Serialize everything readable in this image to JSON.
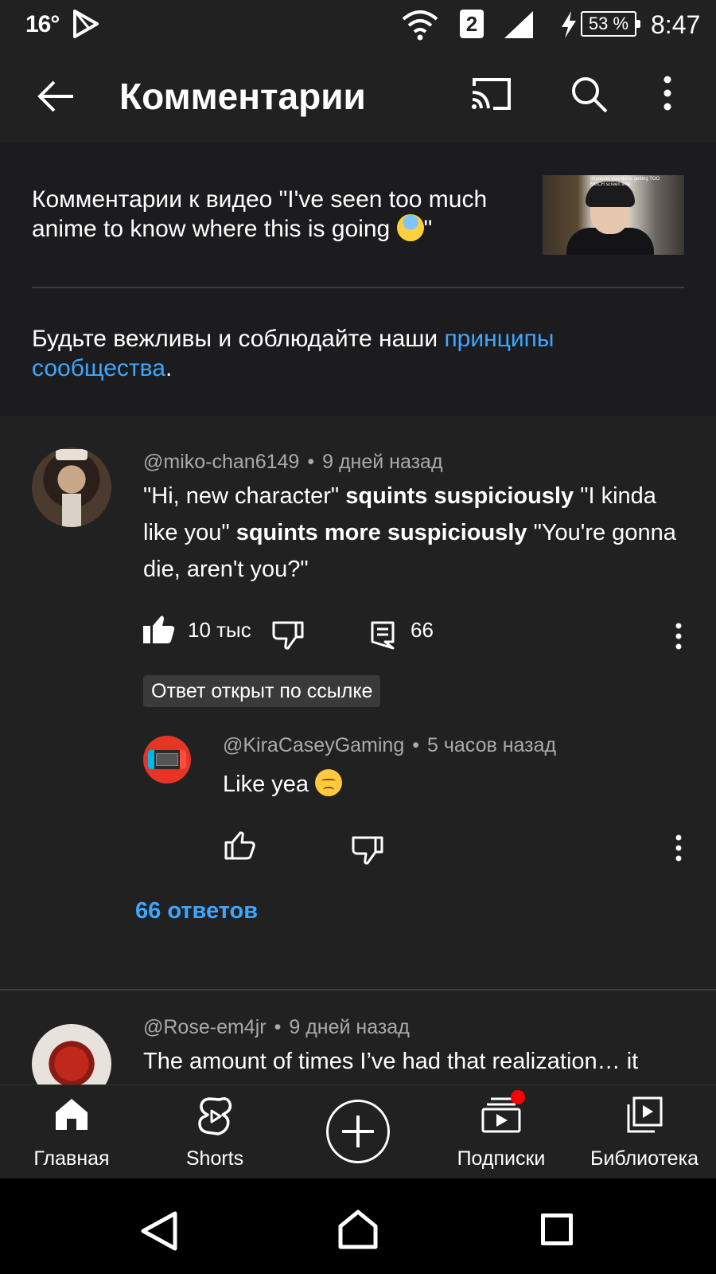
{
  "status_bar": {
    "temperature": "16°",
    "sim_slot": "2",
    "battery": "53 %",
    "time": "8:47"
  },
  "header": {
    "title": "Комментарии"
  },
  "info": {
    "video_title": "Комментарии к видео \"I've seen too much anime to know where this is going ",
    "video_title_end": "\"",
    "thumbnail_caption": "character you like is getting TOO MUCH screen time",
    "guideline_prefix": "Будьте вежливы и соблюдайте наши ",
    "guideline_link": "принципы сообщества",
    "guideline_suffix": "."
  },
  "comments": [
    {
      "author": "@miko-chan6149",
      "time": "9 дней назад",
      "text_1": "\"Hi, new character\" ",
      "bold_1": "squints suspiciously",
      "text_2": " \"I kinda like you\" ",
      "bold_2": "squints more suspiciously",
      "text_3": " \"You're gonna die, aren't you?\"",
      "likes": "10 тыс",
      "replies_count": "66",
      "reply_badge": "Ответ открыт по ссылке",
      "highlighted_reply": {
        "author": "@KiraCaseyGaming",
        "time": "5 часов назад",
        "text": "Like yea "
      },
      "replies_link": "66 ответов"
    },
    {
      "author": "@Rose-em4jr",
      "time": "9 дней назад",
      "text": "The amount of times I’ve had that realization… it"
    }
  ],
  "bottom_nav": {
    "home": "Главная",
    "shorts": "Shorts",
    "subscriptions": "Подписки",
    "library": "Библиотека"
  },
  "colors": {
    "accent_blue": "#3ea6ff",
    "background": "#212121",
    "notification": "#ff0000"
  }
}
